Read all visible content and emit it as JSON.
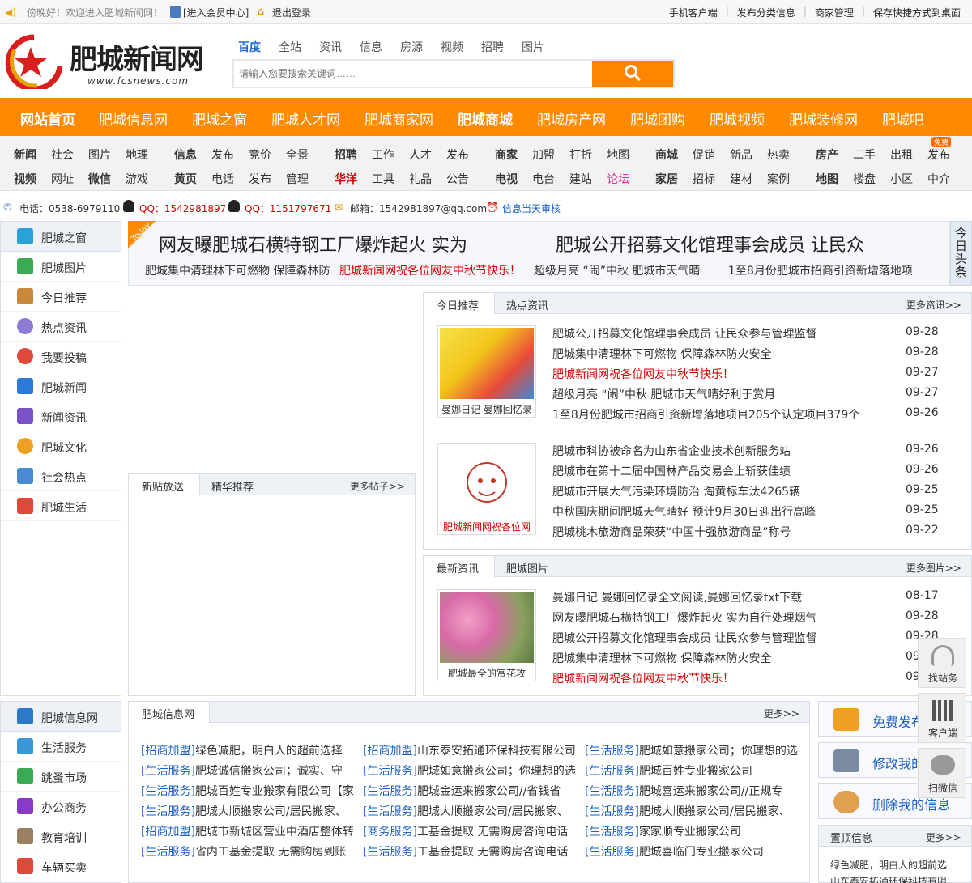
{
  "topbar": {
    "greeting": "傍晚好！欢迎进入肥城新闻网！",
    "member_center": "[进入会员中心]",
    "logout": "退出登录",
    "right_links": [
      "手机客户端",
      "发布分类信息",
      "商家管理",
      "保存快捷方式到桌面"
    ]
  },
  "logo": {
    "title": "肥城新闻网",
    "url": "www.fcsnews.com"
  },
  "search": {
    "tabs": [
      "百度",
      "全站",
      "资讯",
      "信息",
      "房源",
      "视频",
      "招聘",
      "图片"
    ],
    "placeholder": "请输入您要搜索关键词……"
  },
  "mainnav": [
    "网站首页",
    "肥城信息网",
    "肥城之窗",
    "肥城人才网",
    "肥城商家网",
    "肥城商城",
    "肥城房产网",
    "肥城团购",
    "肥城视频",
    "肥城装修网",
    "肥城吧"
  ],
  "subnav": {
    "row1": [
      "新闻",
      "社会",
      "图片",
      "地理",
      "信息",
      "发布",
      "竞价",
      "全景",
      "招聘",
      "工作",
      "人才",
      "发布",
      "商家",
      "加盟",
      "打折",
      "地图",
      "商城",
      "促销",
      "新品",
      "热卖",
      "房产",
      "二手",
      "出租",
      "发布"
    ],
    "row2": [
      "视频",
      "网址",
      "微信",
      "游戏",
      "黄页",
      "电话",
      "发布",
      "管理",
      "华洋",
      "工具",
      "礼品",
      "公告",
      "电视",
      "电台",
      "建站",
      "论坛",
      "家居",
      "招标",
      "建材",
      "案例",
      "地图",
      "楼盘",
      "小区",
      "中介"
    ],
    "free_badge": "免费"
  },
  "contact": {
    "phone": "电话：0538-6979110",
    "qq1": "QQ：1542981897",
    "qq2": "QQ：1151797671",
    "email": "邮箱：1542981897@qq.com",
    "review": "信息当天审核"
  },
  "left_sidebar_top": [
    "肥城之窗",
    "肥城图片",
    "今日推荐",
    "热点资讯",
    "我要投稿",
    "肥城新闻",
    "新闻资讯",
    "肥城文化",
    "社会热点",
    "肥城生活"
  ],
  "left_sidebar_bottom": [
    "肥城信息网",
    "生活服务",
    "跳蚤市场",
    "办公商务",
    "教育培训",
    "车辆买卖"
  ],
  "headlines": {
    "today_badge": "Today",
    "big": [
      "网友曝肥城石横特钢工厂爆炸起火 实为",
      "肥城公开招募文化馆理事会成员 让民众"
    ],
    "small": [
      "肥城集中清理林下可燃物 保障森林防",
      "肥城新闻网祝各位网友中秋节快乐！",
      "超级月亮 “闹”中秋 肥城市天气晴",
      "1至8月份肥城市招商引资新增落地项"
    ],
    "side_label": "今日头条"
  },
  "today_panel": {
    "tabs": [
      "今日推荐",
      "热点资讯"
    ],
    "more": "更多资讯>>",
    "thumb1_caption": "曼娜日记 曼娜回忆录",
    "thumb2_caption": "肥城新闻网祝各位网",
    "group1": [
      {
        "title": "肥城公开招募文化馆理事会成员 让民众参与管理监督",
        "date": "09-28"
      },
      {
        "title": "肥城集中清理林下可燃物 保障森林防火安全",
        "date": "09-28"
      },
      {
        "title": "肥城新闻网祝各位网友中秋节快乐！",
        "date": "09-27"
      },
      {
        "title": "超级月亮 “闹”中秋 肥城市天气晴好利于赏月",
        "date": "09-27"
      },
      {
        "title": "1至8月份肥城市招商引资新增落地项目205个认定项目379个",
        "date": "09-26"
      }
    ],
    "group2": [
      {
        "title": "肥城市科协被命名为山东省企业技术创新服务站",
        "date": "09-26"
      },
      {
        "title": "肥城市在第十二届中国林产品交易会上斩获佳绩",
        "date": "09-26"
      },
      {
        "title": "肥城市开展大气污染环境防治 淘黄标车汰4265辆",
        "date": "09-25"
      },
      {
        "title": "中秋国庆期间肥城天气晴好 预计9月30日迎出行高峰",
        "date": "09-25"
      },
      {
        "title": "肥城桃木旅游商品荣获“中国十强旅游商品”称号",
        "date": "09-22"
      }
    ]
  },
  "forum_panel": {
    "tabs": [
      "新贴放送",
      "精华推荐"
    ],
    "more": "更多帖子>>"
  },
  "latest_panel": {
    "tabs": [
      "最新资讯",
      "肥城图片"
    ],
    "more": "更多图片>>",
    "thumb_caption": "肥城最全的赏花攻",
    "items": [
      {
        "title": "曼娜日记 曼娜回忆录全文阅读,曼娜回忆录txt下载",
        "date": "08-17"
      },
      {
        "title": "网友曝肥城石横特钢工厂爆炸起火 实为自行处理烟气",
        "date": "09-28"
      },
      {
        "title": "肥城公开招募文化馆理事会成员 让民众参与管理监督",
        "date": "09-28"
      },
      {
        "title": "肥城集中清理林下可燃物 保障森林防火安全",
        "date": "09"
      },
      {
        "title": "肥城新闻网祝各位网友中秋节快乐！",
        "date": "09"
      }
    ]
  },
  "info_panel": {
    "title": "肥城信息网",
    "more": "更多>>",
    "rows": [
      [
        [
          "[招商加盟]",
          "绿色减肥，明白人的超前选择"
        ],
        [
          "[招商加盟]",
          "山东泰安拓通环保科技有限公司"
        ],
        [
          "[生活服务]",
          "肥城如意搬家公司；你理想的选"
        ]
      ],
      [
        [
          "[生活服务]",
          "肥城诚信搬家公司；诚实、守"
        ],
        [
          "[生活服务]",
          "肥城如意搬家公司；你理想的选"
        ],
        [
          "[生活服务]",
          "肥城百姓专业搬家公司"
        ]
      ],
      [
        [
          "[生活服务]",
          "肥城百姓专业搬家有限公司【家"
        ],
        [
          "[生活服务]",
          "肥城金运来搬家公司//省钱省"
        ],
        [
          "[生活服务]",
          "肥城喜运来搬家公司//正规专"
        ]
      ],
      [
        [
          "[生活服务]",
          "肥城大顺搬家公司/居民搬家、"
        ],
        [
          "[生活服务]",
          "肥城大顺搬家公司/居民搬家、"
        ],
        [
          "[生活服务]",
          "肥城大顺搬家公司/居民搬家、"
        ]
      ],
      [
        [
          "[招商加盟]",
          "肥城市新城区营业中酒店整体转"
        ],
        [
          "[商务服务]",
          "工基金提取 无需购房咨询电话"
        ],
        [
          "[生活服务]",
          "家家顺专业搬家公司"
        ]
      ],
      [
        [
          "[生活服务]",
          "省内工基金提取 无需购房到账"
        ],
        [
          "[生活服务]",
          "工基金提取 无需购房咨询电话"
        ],
        [
          "[生活服务]",
          "肥城喜临门专业搬家公司"
        ]
      ]
    ]
  },
  "right_actions": [
    "免费发布",
    "修改我的",
    "删除我的信息"
  ],
  "top_info": {
    "title": "置顶信息",
    "more": "更多>>",
    "items": [
      "绿色减肥，明白人的超前选",
      "山东泰安拓通环保科技有限"
    ]
  },
  "float_tools": [
    "找站务",
    "客户端",
    "扫微信"
  ],
  "colors": {
    "accent": "#ff8a00",
    "link_blue": "#1a5fc4",
    "red": "#d40000"
  }
}
